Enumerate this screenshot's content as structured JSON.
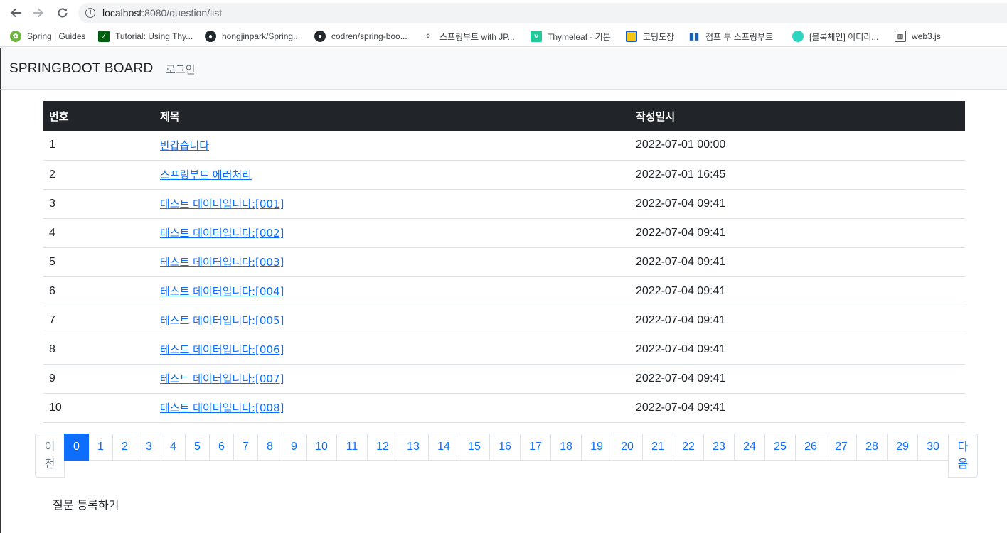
{
  "browser": {
    "url_host": "localhost",
    "url_port_path": ":8080/question/list",
    "bookmarks": [
      {
        "label": "Spring | Guides",
        "icon": "spring-leaf-icon",
        "color": "#6db33f"
      },
      {
        "label": "Tutorial: Using Thy...",
        "icon": "thymeleaf-icon",
        "color": "#005f0f"
      },
      {
        "label": "hongjinpark/Spring...",
        "icon": "github-icon",
        "color": "#24292e"
      },
      {
        "label": "codren/spring-boo...",
        "icon": "github-icon",
        "color": "#24292e"
      },
      {
        "label": "스프링부트 with JP...",
        "icon": "dots-icon",
        "color": "#333333"
      },
      {
        "label": "Thymeleaf - 기본",
        "icon": "velog-icon",
        "color": "#20c997"
      },
      {
        "label": "코딩도장",
        "icon": "codingdojang-icon",
        "color": "#f5c518"
      },
      {
        "label": "점프 투 스프링부트",
        "icon": "wikidocs-icon",
        "color": "#1a5fb4"
      },
      {
        "label": "[블록체인] 이더리...",
        "icon": "blog-icon",
        "color": "#2dd4bf"
      },
      {
        "label": "web3.js",
        "icon": "document-icon",
        "color": "#555555"
      }
    ]
  },
  "navbar": {
    "brand": "SPRINGBOOT BOARD",
    "login": "로그인"
  },
  "table": {
    "headers": {
      "num": "번호",
      "subject": "제목",
      "date": "작성일시"
    },
    "rows": [
      {
        "num": "1",
        "subject": "반갑습니다",
        "date": "2022-07-01 00:00"
      },
      {
        "num": "2",
        "subject": "스프링부트 에러처리",
        "date": "2022-07-01 16:45"
      },
      {
        "num": "3",
        "subject": "테스트 데이터입니다:[001]",
        "date": "2022-07-04 09:41"
      },
      {
        "num": "4",
        "subject": "테스트 데이터입니다:[002]",
        "date": "2022-07-04 09:41"
      },
      {
        "num": "5",
        "subject": "테스트 데이터입니다:[003]",
        "date": "2022-07-04 09:41"
      },
      {
        "num": "6",
        "subject": "테스트 데이터입니다:[004]",
        "date": "2022-07-04 09:41"
      },
      {
        "num": "7",
        "subject": "테스트 데이터입니다:[005]",
        "date": "2022-07-04 09:41"
      },
      {
        "num": "8",
        "subject": "테스트 데이터입니다:[006]",
        "date": "2022-07-04 09:41"
      },
      {
        "num": "9",
        "subject": "테스트 데이터입니다:[007]",
        "date": "2022-07-04 09:41"
      },
      {
        "num": "10",
        "subject": "테스트 데이터입니다:[008]",
        "date": "2022-07-04 09:41"
      }
    ]
  },
  "pagination": {
    "prev": [
      "이",
      "전"
    ],
    "next": [
      "다",
      "음"
    ],
    "pages": [
      "0",
      "1",
      "2",
      "3",
      "4",
      "5",
      "6",
      "7",
      "8",
      "9",
      "10",
      "11",
      "12",
      "13",
      "14",
      "15",
      "16",
      "17",
      "18",
      "19",
      "20",
      "21",
      "22",
      "23",
      "24",
      "25",
      "26",
      "27",
      "28",
      "29",
      "30"
    ],
    "active": "0",
    "accent": "#0d6efd"
  },
  "create_label": "질문 등록하기"
}
